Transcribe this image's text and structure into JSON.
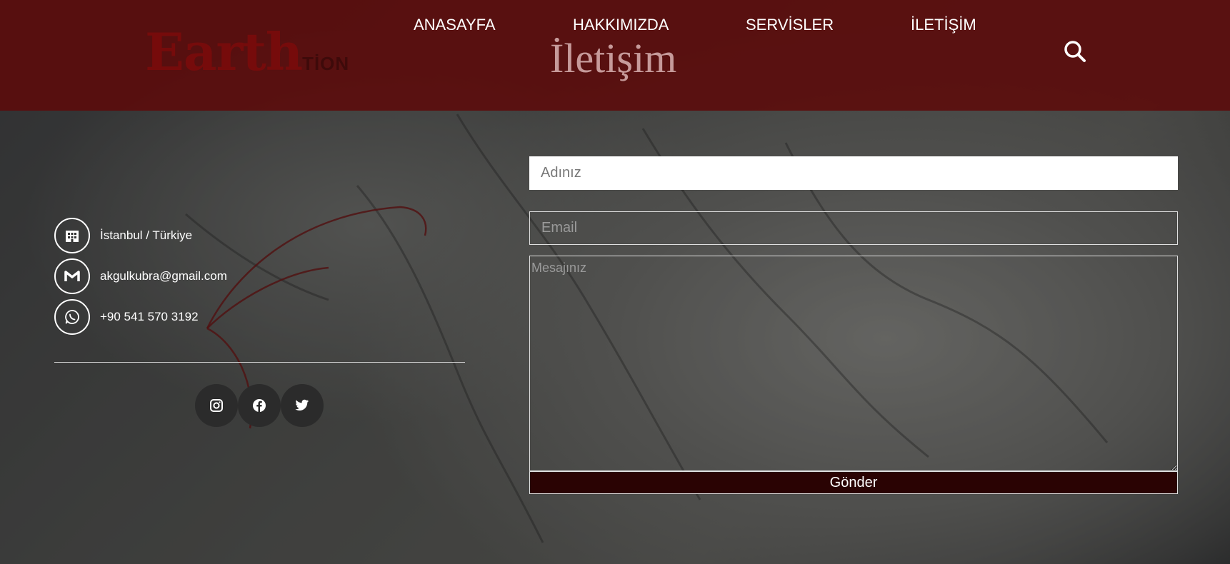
{
  "header": {
    "logo_main": "Earth",
    "logo_suffix": "TİON",
    "page_heading": "İletişim",
    "nav": [
      {
        "label": "ANASAYFA"
      },
      {
        "label": "HAKKIMIZDA"
      },
      {
        "label": "SERVİSLER"
      },
      {
        "label": "İLETİŞİM"
      }
    ],
    "search_icon": "search-icon"
  },
  "contact": {
    "location": "İstanbul / Türkiye",
    "email": "akgulkubra@gmail.com",
    "phone": "+90 541 570 3192",
    "icons": [
      "building-icon",
      "gmail-icon",
      "whatsapp-icon"
    ]
  },
  "socials": [
    {
      "name": "instagram-icon"
    },
    {
      "name": "facebook-icon"
    },
    {
      "name": "twitter-icon"
    }
  ],
  "form": {
    "name_placeholder": "Adınız",
    "email_placeholder": "Email",
    "message_placeholder": "Mesajınız",
    "submit_label": "Gönder"
  },
  "colors": {
    "header_bg": "#5c0a0a",
    "submit_bg": "#2a0303"
  }
}
